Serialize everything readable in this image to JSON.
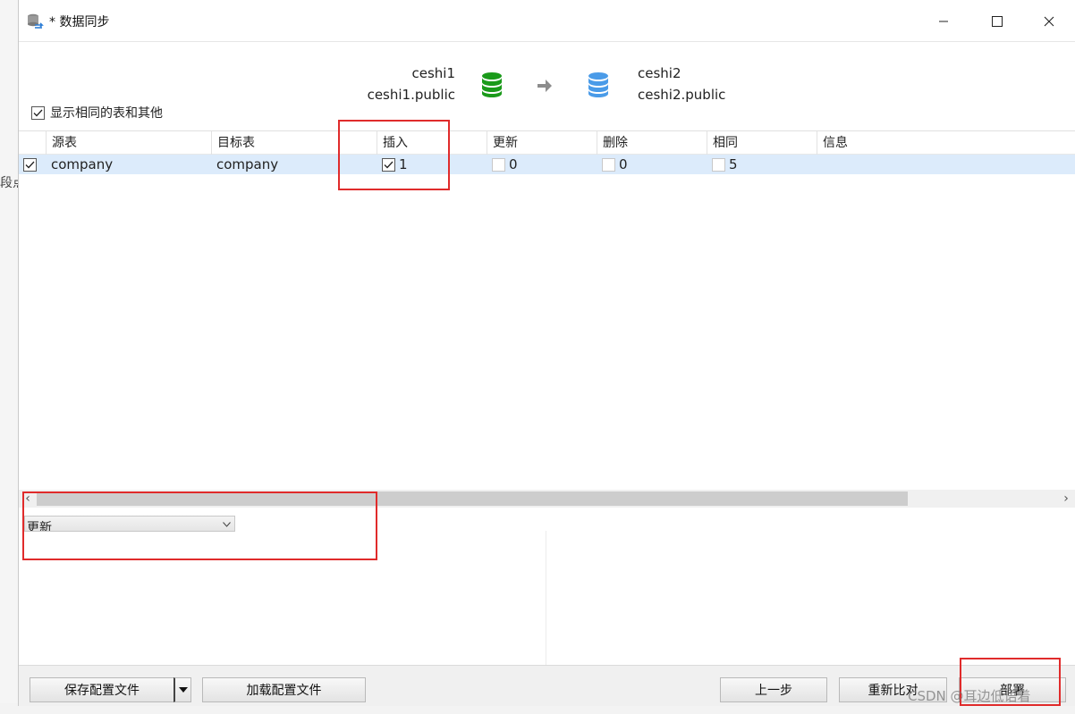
{
  "window": {
    "title": "* 数据同步"
  },
  "source": {
    "connection": "ceshi1",
    "schema": "ceshi1.public",
    "color": "#1a9a1a"
  },
  "target": {
    "connection": "ceshi2",
    "schema": "ceshi2.public",
    "color": "#4a9be8"
  },
  "options": {
    "show_same_label": "显示相同的表和其他",
    "show_same_checked": true
  },
  "grid": {
    "columns": [
      "源表",
      "目标表",
      "插入",
      "更新",
      "删除",
      "相同",
      "信息"
    ],
    "rows": [
      {
        "checked": true,
        "source_table": "company",
        "target_table": "company",
        "insert_checked": true,
        "insert": "1",
        "update_checked": false,
        "update": "0",
        "delete_checked": false,
        "delete": "0",
        "same_checked": false,
        "same": "5",
        "info": ""
      }
    ]
  },
  "lower": {
    "select_value": "更新"
  },
  "footer": {
    "save_config": "保存配置文件",
    "load_config": "加载配置文件",
    "prev": "上一步",
    "recompare": "重新比对",
    "deploy": "部署"
  },
  "background": {
    "left_fragment": "段点",
    "watermark": "CSDN @耳边低语着"
  },
  "annotation_color": "#e02b2b"
}
